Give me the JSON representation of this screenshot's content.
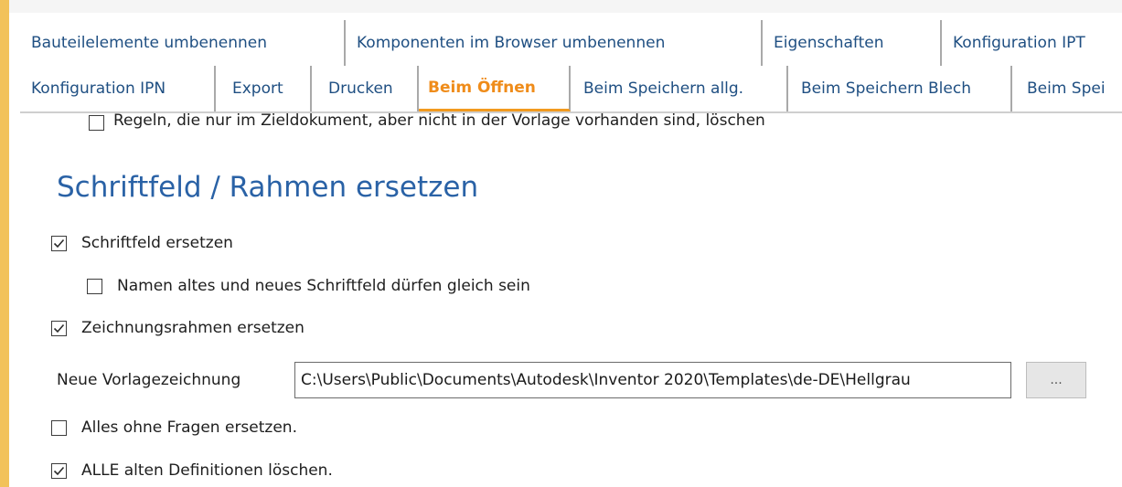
{
  "tabs_row1": [
    {
      "label": "Bauteilelemente umbenennen",
      "width": 356
    },
    {
      "label": "Komponenten im Browser umbenennen",
      "width": 456
    },
    {
      "label": "Eigenschaften",
      "width": 196
    },
    {
      "label": "Konfiguration IPT",
      "width": 197
    }
  ],
  "tabs_row2": [
    {
      "label": "Konfiguration IPN"
    },
    {
      "label": "Export"
    },
    {
      "label": "Drucken"
    },
    {
      "label": "Beim Öffnen"
    },
    {
      "label": "Beim Speichern allg."
    },
    {
      "label": "Beim Speichern Blech"
    },
    {
      "label": "Beim Spei"
    }
  ],
  "options": {
    "regeln_loeschen": {
      "label": "Regeln, die nur im Zieldokument, aber nicht in der Vorlage vorhanden sind, löschen",
      "checked": false
    },
    "schriftfeld_ersetzen": {
      "label": "Schriftfeld ersetzen",
      "checked": true
    },
    "namen_gleich": {
      "label": "Namen altes und neues Schriftfeld dürfen gleich sein",
      "checked": false
    },
    "rahmen_ersetzen": {
      "label": "Zeichnungsrahmen ersetzen",
      "checked": true
    },
    "ohne_fragen": {
      "label": "Alles ohne Fragen ersetzen.",
      "checked": false
    },
    "alte_loeschen": {
      "label": "ALLE alten Definitionen löschen.",
      "checked": true
    }
  },
  "section": {
    "title": "Schriftfeld / Rahmen ersetzen"
  },
  "vorlage": {
    "label": "Neue Vorlagezeichnung",
    "value": "C:\\Users\\Public\\Documents\\Autodesk\\Inventor 2020\\Templates\\de-DE\\Hellgrau",
    "browse_label": "..."
  },
  "colors": {
    "accent": "#ef8c1a",
    "tab_text": "#1f4f82",
    "section_title": "#2a62a6",
    "left_bar": "#f2c25a"
  }
}
